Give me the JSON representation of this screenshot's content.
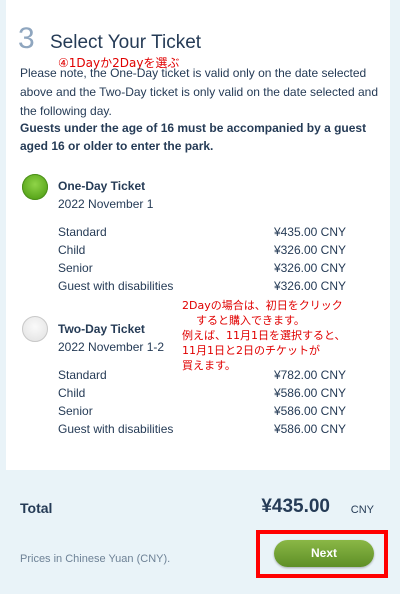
{
  "step": {
    "number": "3",
    "title": "Select Your Ticket",
    "annotation": "④1Dayか2Dayを選ぶ"
  },
  "notes": {
    "validity": "Please note, the One-Day ticket is valid only on the date selected above and the Two-Day ticket is only valid on the date selected and the following day.",
    "age_rule": "Guests under the age of 16 must be accompanied by a guest aged 16 or older to enter the park."
  },
  "tickets": [
    {
      "title": "One-Day Ticket",
      "date": "2022 November 1",
      "selected": true,
      "prices": [
        {
          "label": "Standard",
          "value": "¥435.00 CNY"
        },
        {
          "label": "Child",
          "value": "¥326.00 CNY"
        },
        {
          "label": "Senior",
          "value": "¥326.00 CNY"
        },
        {
          "label": "Guest with disabilities",
          "value": "¥326.00 CNY"
        }
      ]
    },
    {
      "title": "Two-Day Ticket",
      "date": "2022 November 1-2",
      "selected": false,
      "prices": [
        {
          "label": "Standard",
          "value": "¥782.00 CNY"
        },
        {
          "label": "Child",
          "value": "¥586.00 CNY"
        },
        {
          "label": "Senior",
          "value": "¥586.00 CNY"
        },
        {
          "label": "Guest with disabilities",
          "value": "¥586.00 CNY"
        }
      ]
    }
  ],
  "two_day_annotation": {
    "line1": "2Dayの場合は、初日をクリック",
    "line2": "すると購入できます。",
    "line3": "例えば、11月1日を選択すると、",
    "line4": "11月1日と2日のチケットが",
    "line5": "買えます。"
  },
  "footer": {
    "total_label": "Total",
    "total_amount": "¥435.00",
    "total_currency": "CNY",
    "currency_note": "Prices in Chinese Yuan (CNY).",
    "next_label": "Next"
  },
  "colors": {
    "selected_radio": "#5aa71c",
    "next_button": "#6f9e33",
    "annotation_red": "#e00000"
  }
}
